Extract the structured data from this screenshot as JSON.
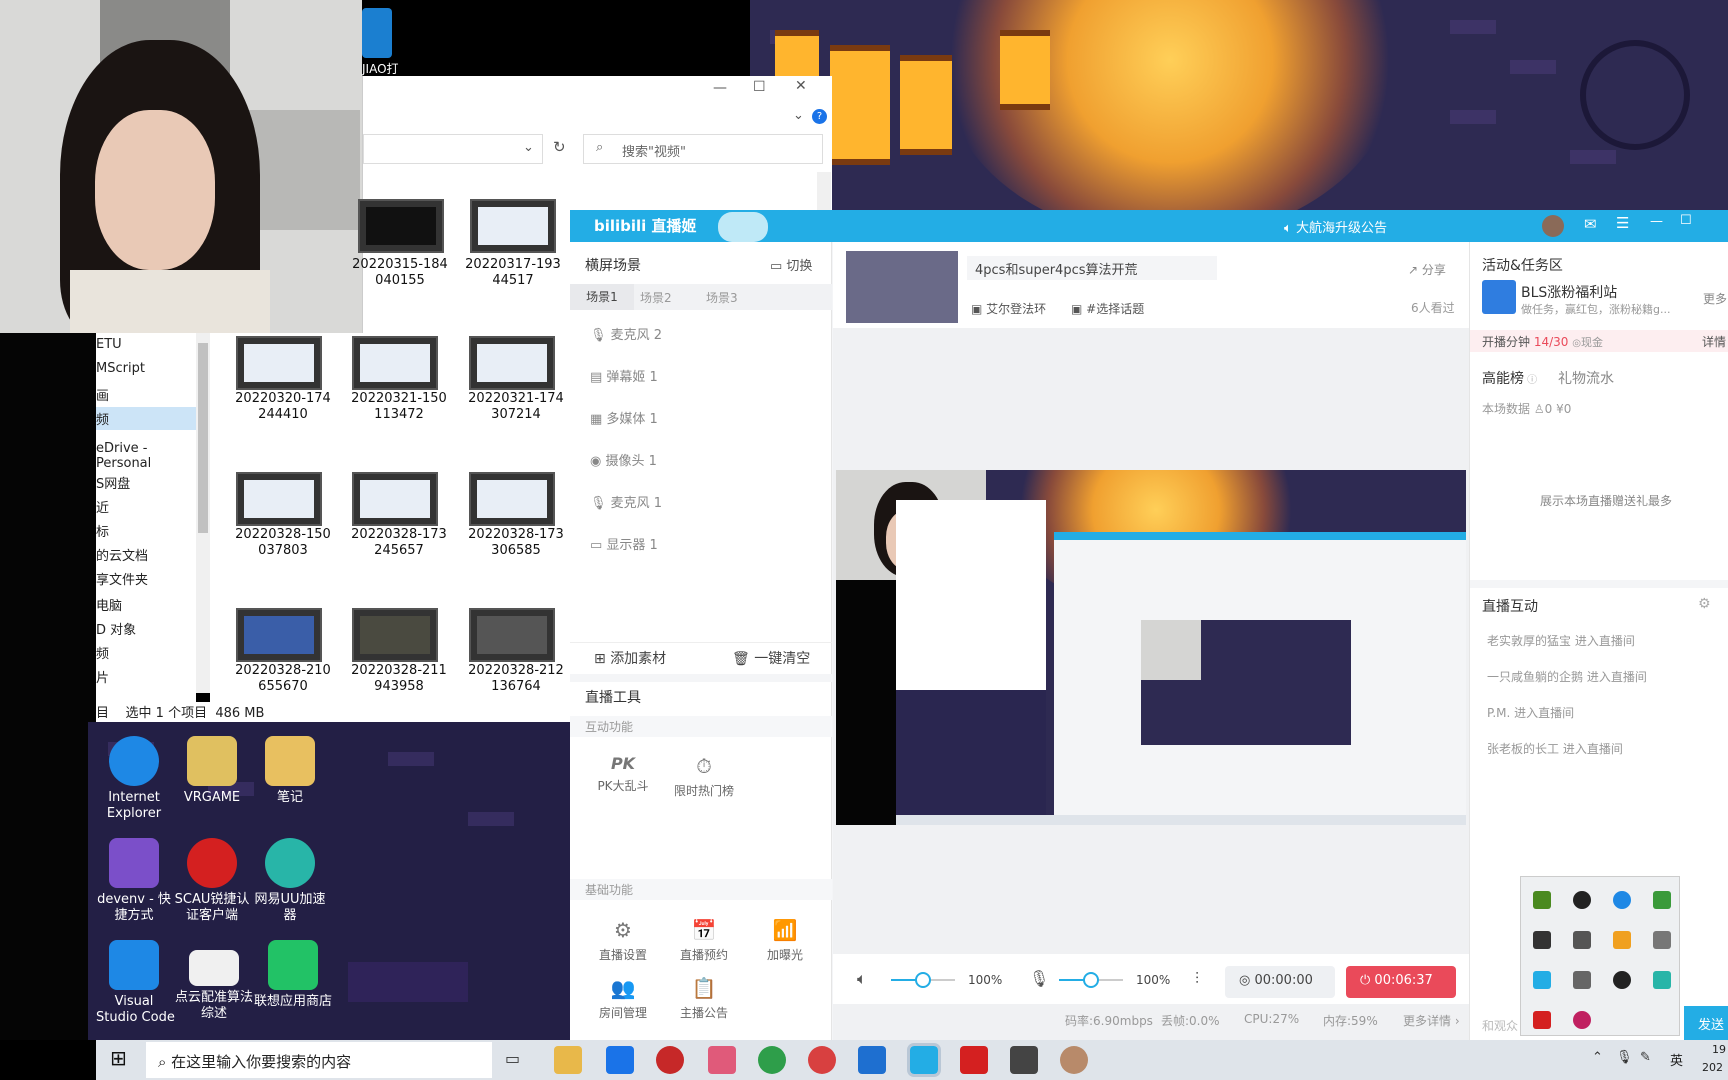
{
  "explorer": {
    "search_placeholder": "搜索\"视频\"",
    "nav": [
      "ETU",
      "MScript",
      "画",
      "频",
      "eDrive - Personal",
      "S网盘",
      "近",
      "标",
      "的云文档",
      "享文件夹",
      "电脑",
      "D 对象",
      "频",
      "片"
    ],
    "files": [
      {
        "name": "20220315-184\n040155"
      },
      {
        "name": "20220317-193\n44517"
      },
      {
        "name": "20220320-174\n244410"
      },
      {
        "name": "20220321-150\n113472"
      },
      {
        "name": "20220321-174\n307214"
      },
      {
        "name": "20220328-150\n037803"
      },
      {
        "name": "20220328-173\n245657"
      },
      {
        "name": "20220328-173\n306585"
      },
      {
        "name": "20220328-210\n655670"
      },
      {
        "name": "20220328-211\n943958"
      },
      {
        "name": "20220328-212\n136764"
      }
    ],
    "status": "目    选中 1 个项目  486 MB",
    "top_icon_label": "JIAO打"
  },
  "desktop": {
    "icons": [
      {
        "label": "Internet\nExplorer",
        "color": "#1e88e5"
      },
      {
        "label": "VRGAME",
        "color": "#e0c060"
      },
      {
        "label": "笔记",
        "color": "#e8c060"
      },
      {
        "label": "devenv - 快\n捷方式",
        "color": "#7b4fc9"
      },
      {
        "label": "SCAU锐捷认\n证客户端",
        "color": "#d42020"
      },
      {
        "label": "网易UU加速\n器",
        "color": "#28b5a8"
      },
      {
        "label": "Visual\nStudio Code",
        "color": "#1e88e5"
      },
      {
        "label": "点云配准算法\n综述",
        "color": "#f0f0f0"
      },
      {
        "label": "联想应用商店",
        "color": "#22c266"
      }
    ]
  },
  "bili": {
    "logo": "bilibili 直播姬",
    "announcement": "大航海升级公告",
    "left": {
      "scene_title": "横屏场景",
      "switch": "切换",
      "tabs": [
        "场景1",
        "场景2",
        "场景3"
      ],
      "sources": [
        {
          "icon": "mic-icon",
          "label": "麦克风 2"
        },
        {
          "icon": "danmaku-icon",
          "label": "弹幕姬 1"
        },
        {
          "icon": "media-icon",
          "label": "多媒体 1"
        },
        {
          "icon": "camera-icon",
          "label": "摄像头 1"
        },
        {
          "icon": "mic-icon",
          "label": "麦克风 1"
        },
        {
          "icon": "monitor-icon",
          "label": "显示器 1"
        }
      ],
      "add_source": "添加素材",
      "clear_all": "一键清空",
      "tools_title": "直播工具",
      "interactive_title": "互动功能",
      "interactive": [
        {
          "glyph": "PK",
          "label": "PK大乱斗"
        },
        {
          "glyph": "⏱",
          "label": "限时热门榜"
        }
      ],
      "basic_title": "基础功能",
      "basic": [
        {
          "glyph": "⚙",
          "label": "直播设置"
        },
        {
          "glyph": "📅",
          "label": "直播预约"
        },
        {
          "glyph": "📶",
          "label": "加曝光"
        },
        {
          "glyph": "👥",
          "label": "房间管理"
        },
        {
          "glyph": "📋",
          "label": "主播公告"
        }
      ]
    },
    "center": {
      "room_title": "4pcs和super4pcs算法开荒",
      "share": "分享",
      "category": "艾尔登法环",
      "topic": "#选择话题",
      "viewers": "6人看过",
      "speaker_volume": "100%",
      "mic_volume": "100%",
      "speaker_level": 0.5,
      "mic_level": 0.5,
      "record_time": "00:00:00",
      "live_time": "00:06:37",
      "stats": {
        "bitrate": "码率:6.90mbps",
        "drop": "丢帧:0.0%",
        "cpu": "CPU:27%",
        "mem": "内存:59%",
        "more": "更多详情"
      }
    },
    "right": {
      "activity_title": "活动&任务区",
      "activity_name": "BLS涨粉福利站",
      "activity_desc": "做任务，赢红包，涨粉秘籍g...",
      "more": "更多",
      "progress_label": "开播分钟",
      "progress_value": "14/30",
      "progress_reward": "现金",
      "details": "详情",
      "rank_tab1": "高能榜",
      "rank_tab2": "礼物流水",
      "session_data": "本场数据",
      "session_count": "0",
      "session_money": "¥0",
      "empty_text": "展示本场直播赠送礼最多",
      "interact_title": "直播互动",
      "messages": [
        "老实敦厚的猛宝 进入直播间",
        "一只咸鱼躺的企鹅 进入直播间",
        "P.M. 进入直播间",
        "张老板的长工 进入直播间"
      ],
      "input_placeholder": "和观众",
      "send": "发送"
    }
  },
  "taskbar": {
    "search": "在这里输入你要搜索的内容",
    "lang": "英",
    "time": "19",
    "date": "202"
  }
}
